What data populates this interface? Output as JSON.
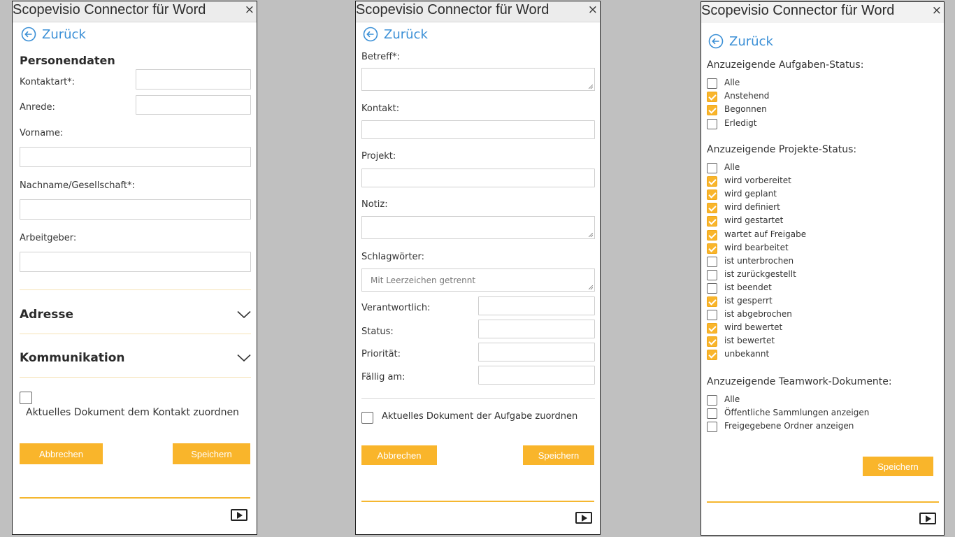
{
  "pane1": {
    "title": "Scopevisio Connector für Word",
    "close": "×",
    "back": "Zurück",
    "section": "Personendaten",
    "fields": {
      "kontaktart": "Kontaktart*:",
      "anrede": "Anrede:",
      "vorname": "Vorname:",
      "nachname": "Nachname/Gesellschaft*:",
      "arbeitgeber": "Arbeitgeber:"
    },
    "adresse": "Adresse",
    "kommunikation": "Kommunikation",
    "checkbox_label": "Aktuelles Dokument dem Kontakt zuordnen",
    "cancel": "Abbrechen",
    "save": "Speichern"
  },
  "pane2": {
    "title": "Scopevisio Connector für Word",
    "close": "×",
    "back": "Zurück",
    "fields": {
      "betreff": "Betreff*:",
      "kontakt": "Kontakt:",
      "projekt": "Projekt:",
      "notiz": "Notiz:",
      "schlagwoerter": "Schlagwörter:",
      "schlagwoerter_placeholder": "Mit Leerzeichen getrennt",
      "verantwortlich": "Verantwortlich:",
      "status": "Status:",
      "prioritaet": "Priorität:",
      "faellig": "Fällig am:"
    },
    "checkbox_label": "Aktuelles Dokument der Aufgabe zuordnen",
    "cancel": "Abbrechen",
    "save": "Speichern"
  },
  "pane3": {
    "title": "Scopevisio Connector für Word",
    "close": "×",
    "back": "Zurück",
    "aufgaben_title": "Anzuzeigende Aufgaben-Status:",
    "aufgaben": [
      {
        "label": "Alle",
        "checked": false
      },
      {
        "label": "Anstehend",
        "checked": true
      },
      {
        "label": "Begonnen",
        "checked": true
      },
      {
        "label": "Erledigt",
        "checked": false
      }
    ],
    "projekte_title": "Anzuzeigende Projekte-Status:",
    "projekte": [
      {
        "label": "Alle",
        "checked": false
      },
      {
        "label": "wird vorbereitet",
        "checked": true
      },
      {
        "label": "wird geplant",
        "checked": true
      },
      {
        "label": "wird definiert",
        "checked": true
      },
      {
        "label": "wird gestartet",
        "checked": true
      },
      {
        "label": "wartet auf Freigabe",
        "checked": true
      },
      {
        "label": "wird bearbeitet",
        "checked": true
      },
      {
        "label": "ist unterbrochen",
        "checked": false
      },
      {
        "label": "ist zurückgestellt",
        "checked": false
      },
      {
        "label": "ist beendet",
        "checked": false
      },
      {
        "label": "ist gesperrt",
        "checked": true
      },
      {
        "label": "ist abgebrochen",
        "checked": false
      },
      {
        "label": "wird bewertet",
        "checked": true
      },
      {
        "label": "ist bewertet",
        "checked": true
      },
      {
        "label": "unbekannt",
        "checked": true
      }
    ],
    "teamwork_title": "Anzuzeigende Teamwork-Dokumente:",
    "teamwork": [
      {
        "label": "Alle",
        "checked": false
      },
      {
        "label": "Öffentliche Sammlungen anzeigen",
        "checked": false
      },
      {
        "label": "Freigegebene Ordner anzeigen",
        "checked": false
      }
    ],
    "save": "Speichern"
  },
  "colors": {
    "accent": "#f9b52b",
    "link": "#3a8fd6",
    "background": "#c0c0c0"
  },
  "icons": {
    "back": "arrow-left-circle-icon",
    "close": "close-icon",
    "chevron": "chevron-down-icon",
    "video": "video-play-icon"
  }
}
